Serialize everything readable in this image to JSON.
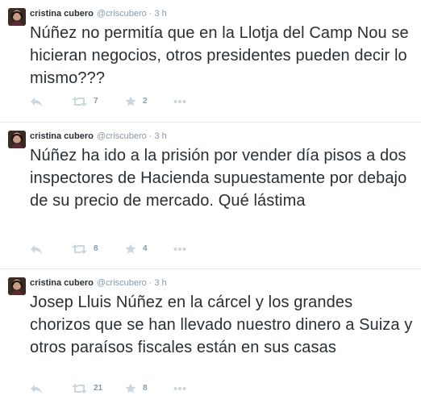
{
  "tweets": [
    {
      "fullname": "cristina cubero",
      "username": "@criscubero",
      "time": "3 h",
      "text": "Núñez no permitía que en la Llotja del Camp Nou se hicieran negocios, otros presidentes pueden decir lo mismo???",
      "retweets": "7",
      "favorites": "2"
    },
    {
      "fullname": "cristina cubero",
      "username": "@criscubero",
      "time": "3 h",
      "text": "Núñez ha ido a la prisión por vender día pisos a dos inspectores de Hacienda supuestamente por debajo de su precio de mercado. Qué lástima",
      "retweets": "8",
      "favorites": "4"
    },
    {
      "fullname": "cristina cubero",
      "username": "@criscubero",
      "time": "3 h",
      "text": "Josep Lluis Núñez en la cárcel y los grandes chorizos que se han llevado nuestro dinero a Suiza y otros paraísos fiscales están en sus casas",
      "retweets": "21",
      "favorites": "8"
    }
  ],
  "header_separator": "·",
  "icons": {
    "reply": "reply-icon",
    "retweet": "retweet-icon",
    "favorite": "star-icon",
    "more": "more-dots-icon"
  },
  "colors": {
    "text": "#292f33",
    "muted": "#8899a6",
    "divider": "#e1e8ed",
    "icon": "#ccd6dd"
  }
}
